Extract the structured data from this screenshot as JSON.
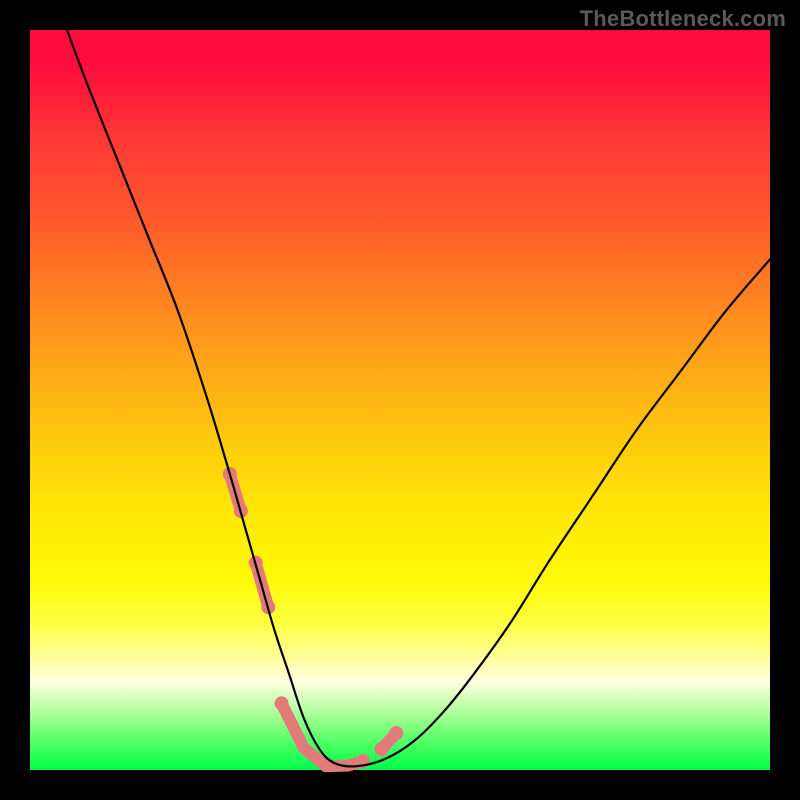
{
  "watermark": "TheBottleneck.com",
  "colors": {
    "page_bg": "#000000",
    "gradient_top": "#ff0a3e",
    "gradient_bottom": "#00ff4a",
    "curve": "#000000",
    "emphasis": "#e37a7a",
    "watermark": "#5a5a5a"
  },
  "chart_data": {
    "type": "line",
    "title": "",
    "xlabel": "",
    "ylabel": "",
    "xlim": [
      0,
      100
    ],
    "ylim": [
      0,
      100
    ],
    "grid": false,
    "legend": false,
    "annotations": [
      "TheBottleneck.com"
    ],
    "series": [
      {
        "name": "curve",
        "x": [
          5,
          8,
          12,
          16,
          20,
          24,
          27,
          29,
          31,
          33,
          35,
          37,
          39,
          41,
          44,
          48,
          52,
          56,
          60,
          65,
          70,
          76,
          82,
          88,
          94,
          100
        ],
        "y": [
          100,
          92,
          82,
          72,
          62,
          50,
          40,
          33,
          26,
          19,
          13,
          7,
          3,
          1,
          0.5,
          1.5,
          4,
          8,
          13,
          20,
          28,
          37,
          46,
          54,
          62,
          69
        ]
      }
    ],
    "emphasis_segments": [
      {
        "x": [
          27,
          28.5
        ],
        "y": [
          40,
          35
        ]
      },
      {
        "x": [
          30.5,
          32.2
        ],
        "y": [
          28,
          22
        ]
      },
      {
        "x": [
          34,
          37,
          40,
          43,
          45
        ],
        "y": [
          9,
          3,
          0.5,
          0.6,
          1.2
        ]
      },
      {
        "x": [
          47.5,
          49.5
        ],
        "y": [
          2.8,
          5.0
        ]
      }
    ],
    "emphasis_points": [
      {
        "x": 27,
        "y": 40
      },
      {
        "x": 28.5,
        "y": 35
      },
      {
        "x": 30.5,
        "y": 28
      },
      {
        "x": 32.2,
        "y": 22
      },
      {
        "x": 34,
        "y": 9
      },
      {
        "x": 45,
        "y": 1.2
      },
      {
        "x": 47.5,
        "y": 2.8
      },
      {
        "x": 49.5,
        "y": 5.0
      }
    ]
  }
}
